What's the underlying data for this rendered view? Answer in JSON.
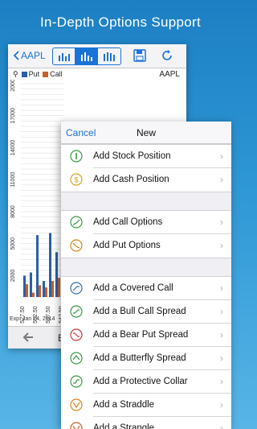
{
  "promo": {
    "title": "In-Depth Options Support"
  },
  "chart_screen": {
    "back_label": "AAPL",
    "ticker": "AAPL",
    "legend": {
      "put": "Put",
      "call": "Call"
    },
    "expiration": "Exp: Jan 24, 2014",
    "bottom_letter": "E",
    "colors": {
      "put": "#2a5fa8",
      "call": "#c8602a",
      "accent": "#1a73d9"
    }
  },
  "chart_data": {
    "type": "bar",
    "ylim": [
      0,
      20000
    ],
    "yticks": [
      "20000",
      "17000",
      "14000",
      "11000",
      "8000",
      "5000",
      "2000"
    ],
    "xticks": [
      "527.50",
      "532.50",
      "537.50",
      "542.50"
    ],
    "series": [
      {
        "name": "Put",
        "values": [
          2000,
          2300,
          5800,
          1500,
          6000,
          4200,
          2500
        ]
      },
      {
        "name": "Call",
        "values": [
          1200,
          400,
          1100,
          900,
          1500,
          1800,
          3000
        ]
      }
    ]
  },
  "menu": {
    "cancel_label": "Cancel",
    "title": "New",
    "groups": [
      [
        {
          "label": "Add Stock Position",
          "icon": "info-icon",
          "color": "#3a9b45"
        },
        {
          "label": "Add Cash Position",
          "icon": "dollar-icon",
          "color": "#d6a21e"
        }
      ],
      [
        {
          "label": "Add Call Options",
          "icon": "call-curve-icon",
          "color": "#3a9b45"
        },
        {
          "label": "Add Put Options",
          "icon": "put-curve-icon",
          "color": "#d6861e"
        }
      ],
      [
        {
          "label": "Add a Covered Call",
          "icon": "covered-call-icon",
          "color": "#3a6fb0"
        },
        {
          "label": "Add a Bull Call Spread",
          "icon": "bull-spread-icon",
          "color": "#3a9b45"
        },
        {
          "label": "Add a Bear Put Spread",
          "icon": "bear-spread-icon",
          "color": "#c8393a"
        },
        {
          "label": "Add a Butterfly Spread",
          "icon": "butterfly-icon",
          "color": "#3a9b45"
        },
        {
          "label": "Add a Protective Collar",
          "icon": "collar-icon",
          "color": "#3a9b45"
        },
        {
          "label": "Add a Straddle",
          "icon": "straddle-icon",
          "color": "#d6861e"
        },
        {
          "label": "Add a Strangle",
          "icon": "strangle-icon",
          "color": "#c8602a"
        }
      ]
    ]
  }
}
